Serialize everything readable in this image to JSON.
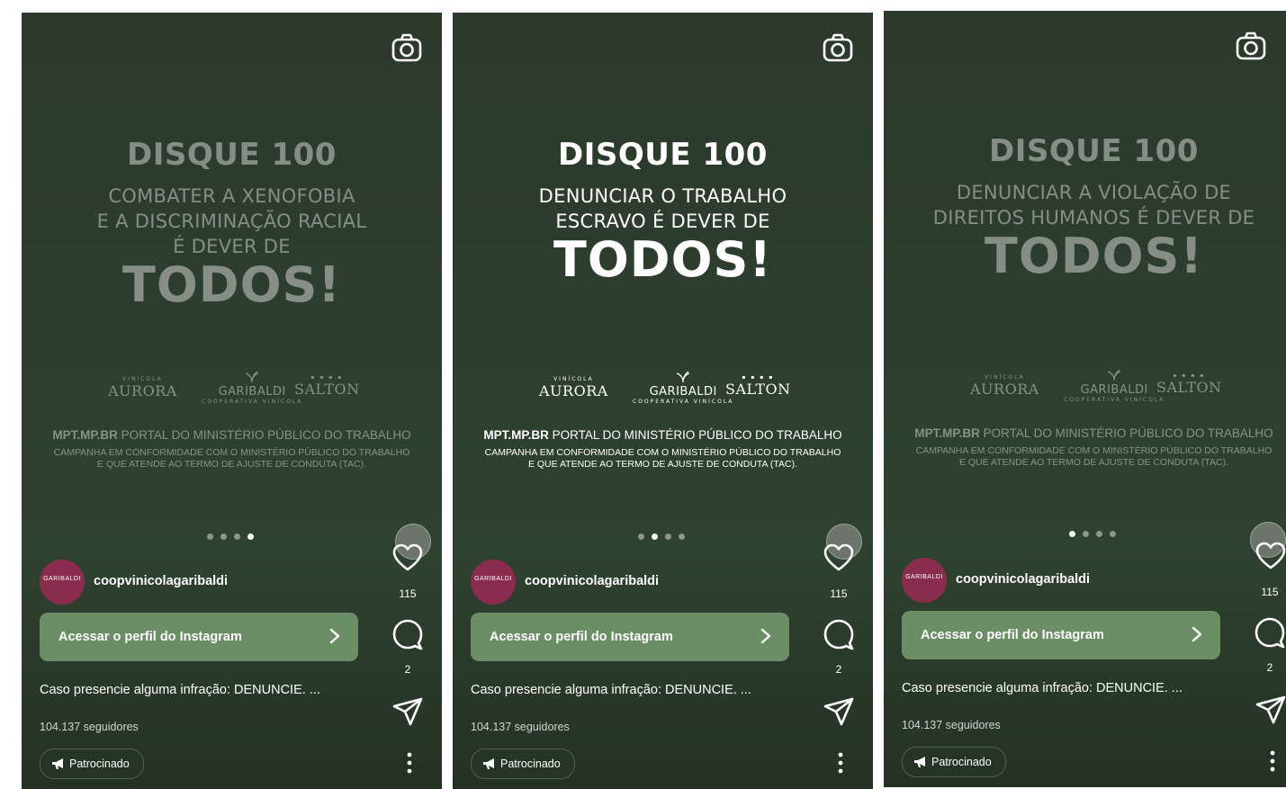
{
  "panels": [
    {
      "headline": "DISQUE 100",
      "sub_lines": [
        "COMBATER A XENOFOBIA",
        "E A DISCRIMINAÇÃO RACIAL",
        "É DEVER DE"
      ],
      "todos": "TODOS!",
      "active_dot": 4,
      "dimmed": true
    },
    {
      "headline": "DISQUE 100",
      "sub_lines": [
        "DENUNCIAR O TRABALHO",
        "ESCRAVO É DEVER DE"
      ],
      "todos": "TODOS!",
      "active_dot": 2,
      "dimmed": false
    },
    {
      "headline": "DISQUE 100",
      "sub_lines": [
        "DENUNCIAR A VIOLAÇÃO DE",
        "DIREITOS HUMANOS É DEVER DE"
      ],
      "todos": "TODOS!",
      "active_dot": 1,
      "dimmed": true
    }
  ],
  "logos": {
    "aurora_small": "VINÍCOLA",
    "aurora": "AURORA",
    "garibaldi": "GARIBALDI",
    "garibaldi_small": "COOPERATIVA VINÍCOLA",
    "salton": "SALTON"
  },
  "mpt": {
    "site": "MPT.MP.BR",
    "portal": "PORTAL DO MINISTÉRIO PÚBLICO DO TRABALHO",
    "fine_1": "CAMPANHA EM CONFORMIDADE COM O MINISTÉRIO PÚBLICO DO TRABALHO",
    "fine_2": "E QUE ATENDE AO TERMO DE AJUSTE DE CONDUTA (TAC)."
  },
  "account": {
    "username": "coopvinicolagaribaldi",
    "avatar_text": "GARIBALDI"
  },
  "cta_label": "Acessar o perfil do Instagram",
  "caption": "Caso presencie alguma infração: DENUNCIE. ...",
  "followers": "104.137 seguidores",
  "sponsored_label": "Patrocinado",
  "likes": "115",
  "comments": "2",
  "icons": [
    "camera-icon",
    "heart-icon",
    "comment-icon",
    "send-icon",
    "more-icon",
    "megaphone-icon",
    "chevron-right-icon"
  ],
  "colors": {
    "background": "#2e3e2e",
    "cta": "#6b8e66",
    "avatar": "#8a2c4e"
  }
}
